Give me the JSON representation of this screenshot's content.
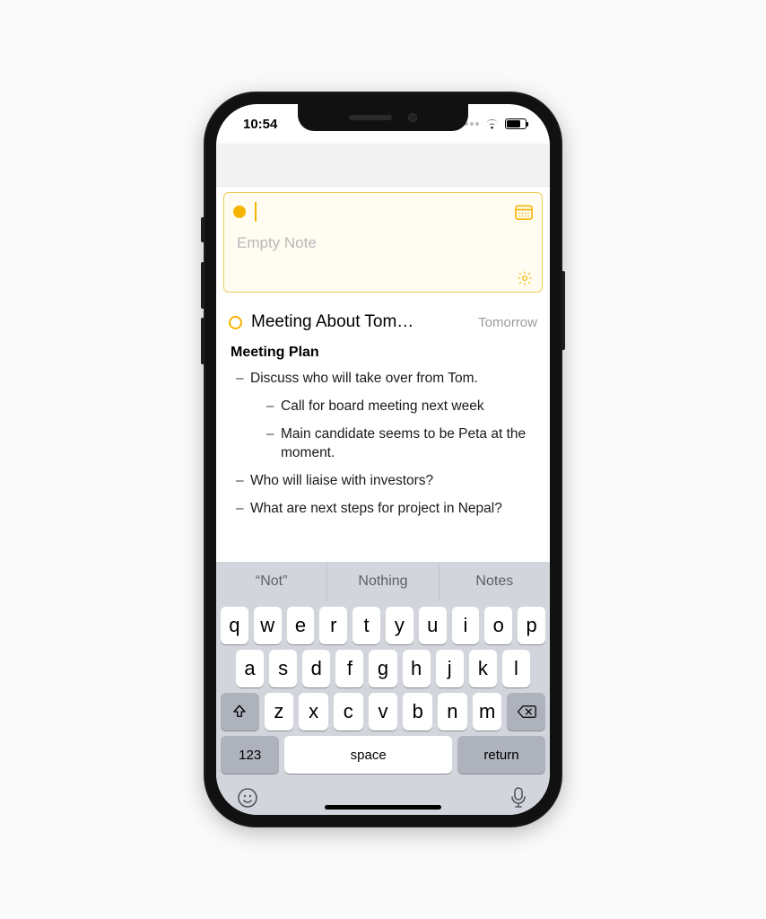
{
  "status": {
    "time": "10:54"
  },
  "new_note": {
    "placeholder": "Empty Note"
  },
  "note": {
    "title": "Meeting About Tom…",
    "date": "Tomorrow",
    "section_heading": "Meeting Plan",
    "bullets": {
      "b1": "Discuss who will take over from Tom.",
      "b1a": "Call for board meeting next week",
      "b1b": "Main candidate seems to be Peta at the moment.",
      "b2": "Who will liaise with investors?",
      "b3": "What are next steps for project in Nepal?"
    }
  },
  "keyboard": {
    "suggestions": {
      "s1": "“Not”",
      "s2": "Nothing",
      "s3": "Notes"
    },
    "row1": {
      "k0": "q",
      "k1": "w",
      "k2": "e",
      "k3": "r",
      "k4": "t",
      "k5": "y",
      "k6": "u",
      "k7": "i",
      "k8": "o",
      "k9": "p"
    },
    "row2": {
      "k0": "a",
      "k1": "s",
      "k2": "d",
      "k3": "f",
      "k4": "g",
      "k5": "h",
      "k6": "j",
      "k7": "k",
      "k8": "l"
    },
    "row3": {
      "k0": "z",
      "k1": "x",
      "k2": "c",
      "k3": "v",
      "k4": "b",
      "k5": "n",
      "k6": "m"
    },
    "numkey": "123",
    "space": "space",
    "return": "return"
  }
}
